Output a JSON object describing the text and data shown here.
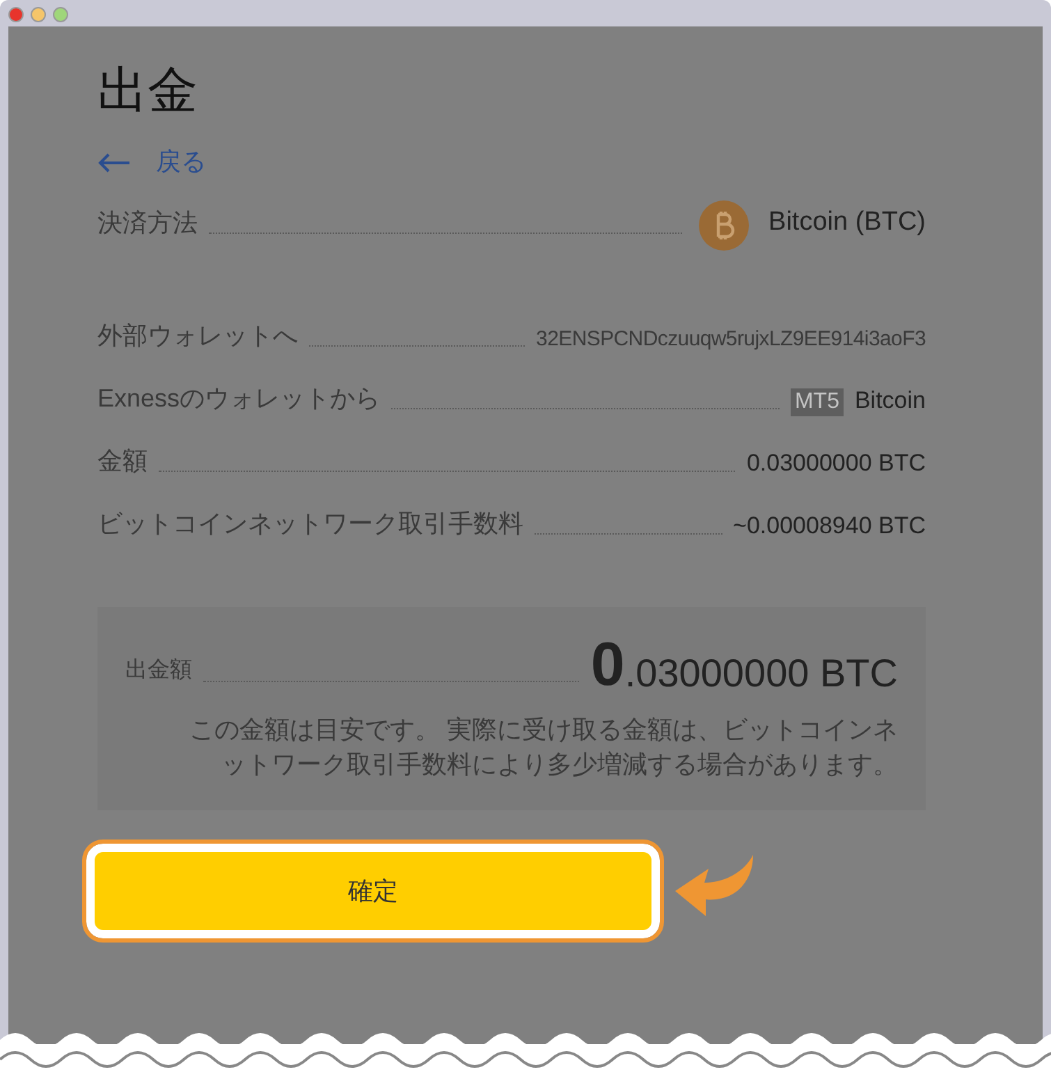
{
  "title": "出金",
  "back_link": {
    "label": "戻る"
  },
  "details": [
    {
      "kind": "coin",
      "label": "決済方法",
      "value": "Bitcoin (BTC)"
    },
    {
      "kind": "address",
      "label": "外部ウォレットへ",
      "value": "32ENSPCNDczuuqw5rujxLZ9EE914i3aoF3"
    },
    {
      "kind": "wallet",
      "label": "Exnessのウォレットから",
      "badge": "MT5",
      "value": "Bitcoin"
    },
    {
      "kind": "plain",
      "label": "金額",
      "value": "0.03000000 BTC"
    },
    {
      "kind": "plain",
      "label": "ビットコインネットワーク取引手数料",
      "value": "~0.00008940 BTC"
    }
  ],
  "summary": {
    "label": "出金額",
    "amount_whole": "0",
    "amount_rest": ".03000000 BTC",
    "note": "この金額は目安です。 実際に受け取る金額は、ビットコインネットワーク取引手数料により多少増減する場合があります。"
  },
  "confirm_button": {
    "label": "確定"
  }
}
